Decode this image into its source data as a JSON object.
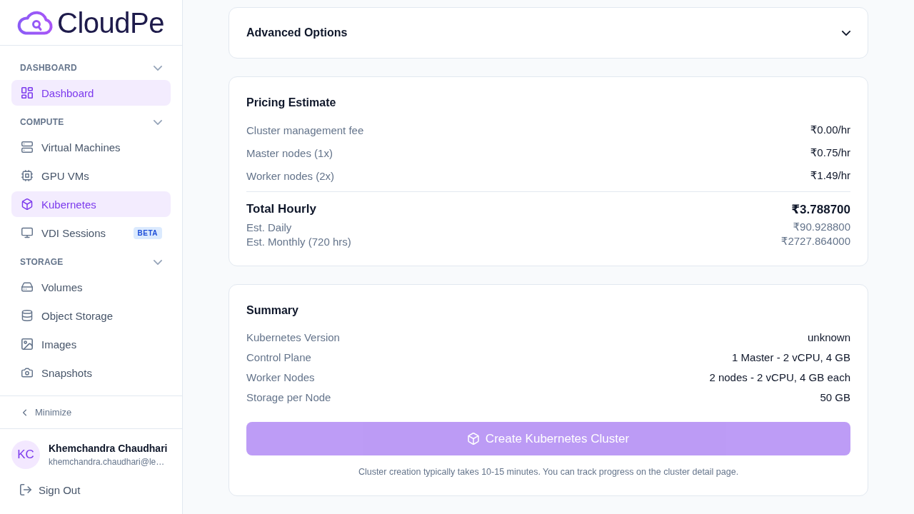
{
  "sidebar": {
    "logo": {
      "text": "CloudPe"
    },
    "sections": [
      {
        "title": "DASHBOARD",
        "expanded": true,
        "items": [
          {
            "label": "Dashboard",
            "selected": true
          }
        ]
      },
      {
        "title": "COMPUTE",
        "expanded": true,
        "items": [
          {
            "label": "Virtual Machines",
            "selected": false
          },
          {
            "label": "GPU VMs",
            "selected": false
          },
          {
            "label": "Kubernetes",
            "selected": true
          },
          {
            "label": "VDI Sessions",
            "selected": false,
            "badge": "BETA"
          }
        ]
      },
      {
        "title": "STORAGE",
        "expanded": true,
        "items": [
          {
            "label": "Volumes",
            "selected": false
          },
          {
            "label": "Object Storage",
            "selected": false
          },
          {
            "label": "Images",
            "selected": false
          },
          {
            "label": "Snapshots",
            "selected": false
          }
        ]
      }
    ],
    "minimize": {
      "label": "Minimize"
    },
    "user": {
      "initials": "KC",
      "name": "Khemchandra Chaudhari",
      "email": "khemchandra.chaudhari@le…"
    },
    "sign_out": {
      "label": "Sign Out"
    }
  },
  "advanced_options": {
    "title": "Advanced Options",
    "expanded": false
  },
  "pricing_estimate": {
    "title": "Pricing Estimate",
    "lines": [
      {
        "label": "Cluster management fee",
        "value": "₹0.00/hr"
      },
      {
        "label": "Master nodes (1x)",
        "value": "₹0.75/hr"
      },
      {
        "label": "Worker nodes (2x)",
        "value": "₹1.49/hr"
      }
    ],
    "total": {
      "label": "Total Hourly",
      "value": "₹3.788700"
    },
    "estimates": [
      {
        "label": "Est. Daily",
        "value": "₹90.928800"
      },
      {
        "label": "Est. Monthly (720 hrs)",
        "value": "₹2727.864000"
      }
    ]
  },
  "summary": {
    "title": "Summary",
    "rows": [
      {
        "label": "Kubernetes Version",
        "value": "unknown"
      },
      {
        "label": "Control Plane",
        "value": "1 Master - 2 vCPU, 4 GB"
      },
      {
        "label": "Worker Nodes",
        "value": "2 nodes - 2 vCPU, 4 GB each"
      },
      {
        "label": "Storage per Node",
        "value": "50 GB"
      }
    ],
    "create_button": {
      "label": "Create Kubernetes Cluster",
      "disabled": true
    },
    "note": "Cluster creation typically takes 10-15 minutes. You can track progress on the cluster detail page."
  }
}
